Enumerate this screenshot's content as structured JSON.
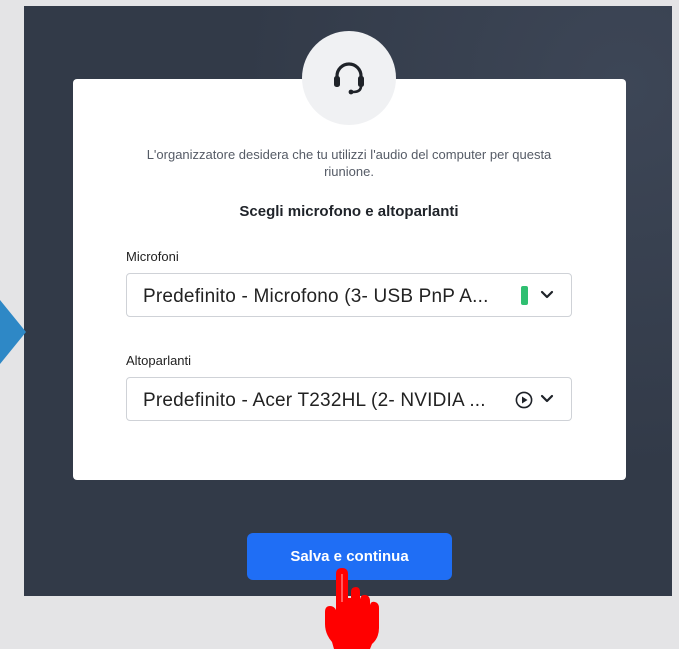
{
  "dialog": {
    "intro_text": "L'organizzatore desidera che tu utilizzi l'audio del computer per questa riunione.",
    "heading": "Scegli microfono e altoparlanti"
  },
  "microphone": {
    "label": "Microfoni",
    "selected": "Predefinito - Microfono (3- USB PnP A...",
    "level_icon": "mic-level-indicator"
  },
  "speakers": {
    "label": "Altoparlanti",
    "selected": "Predefinito - Acer T232HL (2- NVIDIA ...",
    "test_icon": "play-circle-icon"
  },
  "actions": {
    "save_label": "Salva e continua"
  },
  "colors": {
    "panel": "#323a48",
    "primary": "#1f6ef5",
    "level": "#2fbf71",
    "pointer": "#ff0000"
  }
}
